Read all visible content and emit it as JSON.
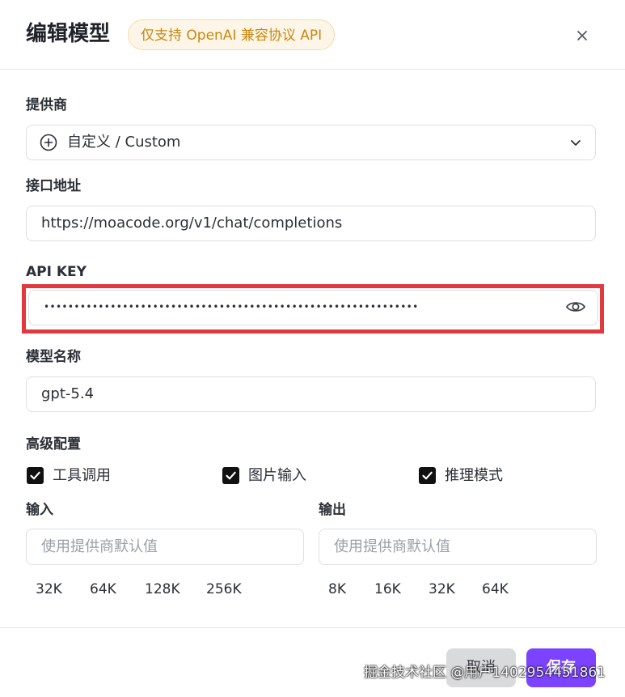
{
  "header": {
    "title": "编辑模型",
    "badge": "仅支持 OpenAI 兼容协议 API"
  },
  "provider": {
    "label": "提供商",
    "value": "自定义 / Custom"
  },
  "endpoint": {
    "label": "接口地址",
    "value": "https://moacode.org/v1/chat/completions"
  },
  "api_key": {
    "label": "API KEY",
    "masked_value": "••••••••••••••••••••••••••••••••••••••••••••••••••••••••••••••"
  },
  "model_name": {
    "label": "模型名称",
    "value": "gpt-5.4"
  },
  "advanced": {
    "label": "高级配置",
    "checkboxes": [
      {
        "label": "工具调用",
        "checked": true
      },
      {
        "label": "图片输入",
        "checked": true
      },
      {
        "label": "推理模式",
        "checked": true
      }
    ]
  },
  "input_ctx": {
    "label": "输入",
    "placeholder": "使用提供商默认值",
    "presets": [
      "32K",
      "64K",
      "128K",
      "256K"
    ]
  },
  "output_ctx": {
    "label": "输出",
    "placeholder": "使用提供商默认值",
    "presets": [
      "8K",
      "16K",
      "32K",
      "64K"
    ]
  },
  "footer": {
    "cancel_label": "取消",
    "save_label": "保存"
  },
  "watermark": "掘金技术社区 @用户1402954451861",
  "colors": {
    "accent": "#7b42ff",
    "highlight": "#e0393e",
    "badge_text": "#c9870e"
  }
}
